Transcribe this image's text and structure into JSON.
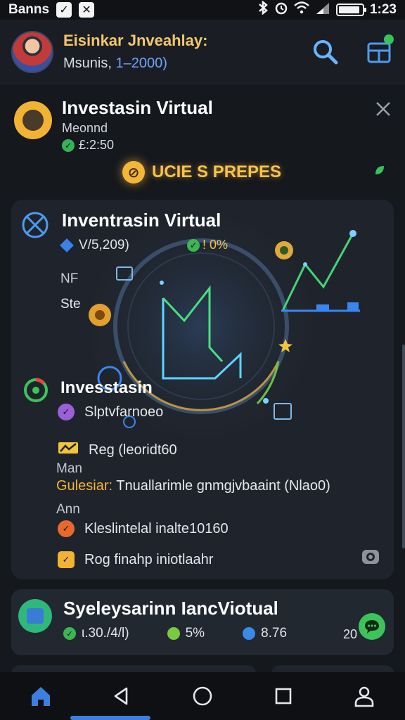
{
  "status_bar": {
    "carrier": "Banns",
    "time": "1:23",
    "battery_level": 0.9
  },
  "header": {
    "title": "Eisinkar Jnveahlay:",
    "subtitle_prefix": "Msunis, ",
    "subtitle_number": "1‒2000)",
    "icons": [
      "search-icon",
      "wallet-icon"
    ]
  },
  "promo": {
    "title": "Investasin Virtual",
    "subtitle": "Meonnd",
    "value": "£:2:50",
    "pill_label": "UCIE S PREPES",
    "pill_icon_glyph": "⊘"
  },
  "main_card": {
    "title": "Inventrasin Virtual",
    "stat_value": "V/5,209)",
    "stat_change": "! 0%",
    "label_nf": "NF",
    "label_st": "Ste",
    "section_title": "Invesstasin",
    "rows": [
      {
        "text": "Slptvfarnoeo",
        "icon_color": "#9b5fd6"
      },
      {
        "text": "Reg (leoridt60",
        "icon_color": "#f2c53a"
      }
    ],
    "label_man": "Man",
    "guide_prefix": "Gulesiar:",
    "guide_text": " Tnuallarimle gnmgjvbaaint (Nlao0)",
    "label_ann": "Ann",
    "rows2": [
      {
        "text": "Kleslintelal  inalte10160",
        "icon_color": "#e8692e"
      },
      {
        "text": "Rog finahp iniotlaahr",
        "icon_color": "#f2b233"
      }
    ]
  },
  "card2": {
    "title": "Syeleysarinn IancViotual",
    "stats": [
      {
        "text": "ι.30./4/l)",
        "color": "#3db553"
      },
      {
        "text": "5%",
        "color": "#7ac943"
      },
      {
        "text": "8.76",
        "color": "#3a8be8"
      }
    ],
    "extra": "20"
  },
  "colors": {
    "accent_gold": "#f4c76b",
    "accent_blue": "#3d7fe0",
    "accent_green": "#3cc45a"
  },
  "navbar": {
    "items": [
      "home-icon",
      "back-icon",
      "home-circle-icon",
      "recents-icon",
      "profile-icon"
    ]
  }
}
